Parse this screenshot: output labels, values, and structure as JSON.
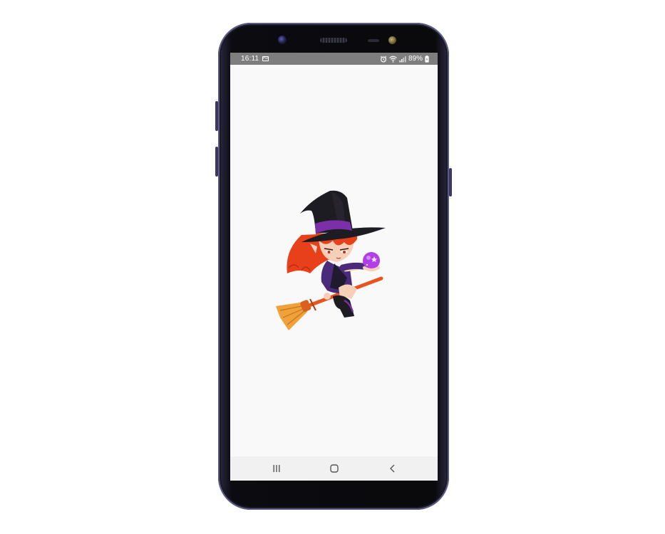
{
  "status_bar": {
    "time": "16:11",
    "notification_icon": "hd-badge-icon",
    "alarm_icon": "alarm-icon",
    "wifi_icon": "wifi-icon",
    "signal_icon": "signal-icon",
    "battery_percent": "89%",
    "battery_icon": "battery-charging-icon"
  },
  "screen": {
    "background_color": "#f9f9f9",
    "illustration": "witch-on-broom-illustration"
  },
  "nav_bar": {
    "recents_icon": "recents-icon",
    "home_icon": "home-icon",
    "back_icon": "back-icon"
  },
  "colors": {
    "hat": "#1c1c22",
    "hat_band": "#7b2fa8",
    "hair": "#e8401a",
    "orb": "#b23ee8",
    "broom_handle": "#e8541e",
    "broom_bristles": "#f0a13a",
    "dress": "#4a2a7a"
  }
}
